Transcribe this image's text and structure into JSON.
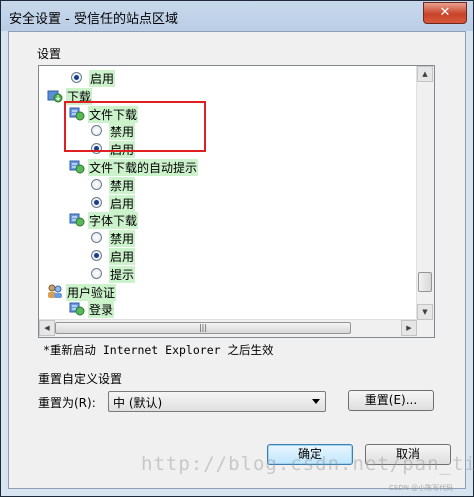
{
  "window": {
    "title": "安全设置 - 受信任的站点区域",
    "close_glyph": "✕"
  },
  "settings_label": "设置",
  "tree": [
    {
      "type": "radio",
      "label": "启用",
      "checked": true
    },
    {
      "type": "category",
      "label": "下载",
      "icon": "download-settings-icon"
    },
    {
      "type": "category",
      "label": "文件下载",
      "icon": "settings-node-icon"
    },
    {
      "type": "radio",
      "label": "禁用",
      "checked": false
    },
    {
      "type": "radio",
      "label": "启用",
      "checked": true
    },
    {
      "type": "category",
      "label": "文件下载的自动提示",
      "icon": "settings-node-icon"
    },
    {
      "type": "radio",
      "label": "禁用",
      "checked": false
    },
    {
      "type": "radio",
      "label": "启用",
      "checked": true
    },
    {
      "type": "category",
      "label": "字体下载",
      "icon": "settings-node-icon"
    },
    {
      "type": "radio",
      "label": "禁用",
      "checked": false
    },
    {
      "type": "radio",
      "label": "启用",
      "checked": true
    },
    {
      "type": "radio",
      "label": "提示",
      "checked": false
    },
    {
      "type": "category",
      "label": "用户验证",
      "icon": "users-icon"
    },
    {
      "type": "category",
      "label": "登录",
      "icon": "settings-node-icon"
    }
  ],
  "restart_note": "*重新启动 Internet Explorer 之后生效",
  "reset_group_label": "重置自定义设置",
  "reset_to_label": "重置为(R):",
  "reset_combo_value": "中 (默认)",
  "reset_button": "重置(E)...",
  "ok_button": "确定",
  "cancel_button": "取消",
  "watermark": "http://blog.csdn.net/pan_tian",
  "csdn_mark": "CSDN @小陈写代码"
}
